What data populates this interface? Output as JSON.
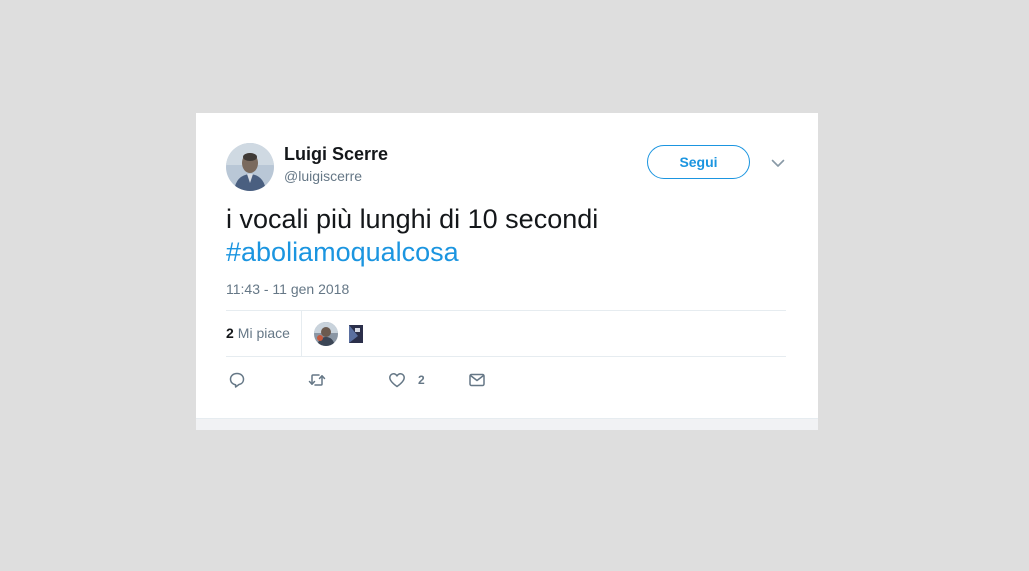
{
  "tweet": {
    "author": {
      "name": "Luigi Scerre",
      "handle": "@luigiscerre"
    },
    "follow_label": "Segui",
    "text": "i vocali più lunghi di 10 secondi",
    "hashtag": "#aboliamoqualcosa",
    "timestamp": "11:43 - 11 gen 2018",
    "stats": {
      "likes_count": "2",
      "likes_label": "Mi piace"
    },
    "actions": {
      "like_count": "2"
    }
  },
  "colors": {
    "page_background": "#dedede",
    "card_background": "#ffffff",
    "accent": "#1b95e0",
    "secondary_text": "#657786",
    "primary_text": "#14171a"
  },
  "icons": [
    "reply-icon",
    "retweet-icon",
    "like-icon",
    "direct-message-icon",
    "chevron-down-icon"
  ]
}
